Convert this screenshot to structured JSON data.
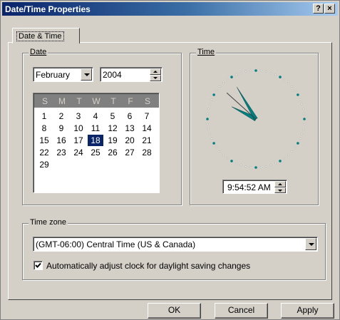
{
  "window": {
    "title": "Date/Time Properties",
    "help_label": "?",
    "close_label": "×"
  },
  "tabs": [
    {
      "label": "Date & Time"
    }
  ],
  "date": {
    "legend": "Date",
    "month_value": "February",
    "year_value": "2004",
    "weekday_headers": [
      "S",
      "M",
      "T",
      "W",
      "T",
      "F",
      "S"
    ],
    "days": [
      "1",
      "2",
      "3",
      "4",
      "5",
      "6",
      "7",
      "8",
      "9",
      "10",
      "11",
      "12",
      "13",
      "14",
      "15",
      "16",
      "17",
      "18",
      "19",
      "20",
      "21",
      "22",
      "23",
      "24",
      "25",
      "26",
      "27",
      "28",
      "29"
    ],
    "selected_day": "18",
    "first_weekday_index": 0
  },
  "time": {
    "legend": "Time",
    "value": "9:54:52 AM",
    "hour": 9,
    "minute": 54,
    "second": 52,
    "hand_color": "#008080"
  },
  "timezone": {
    "legend": "Time zone",
    "value": "(GMT-06:00) Central Time (US & Canada)",
    "dst_checkbox_label": "Automatically adjust clock for daylight saving changes",
    "dst_checked": true
  },
  "buttons": {
    "ok": "OK",
    "cancel": "Cancel",
    "apply": "Apply"
  }
}
